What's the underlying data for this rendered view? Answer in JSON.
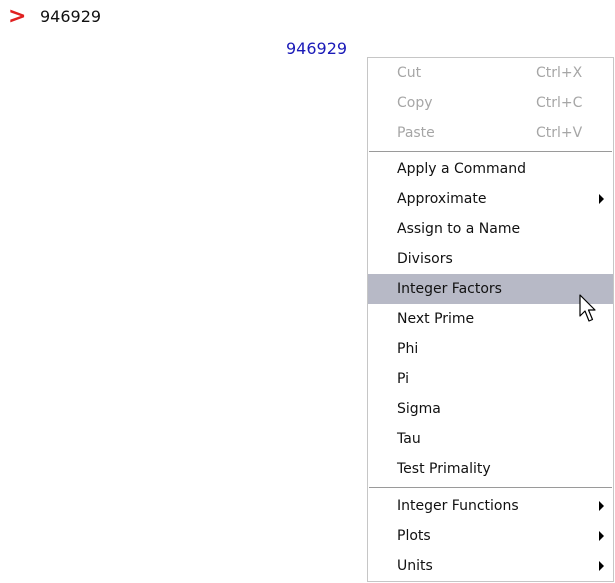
{
  "worksheet": {
    "prompt_symbol": ">",
    "input": "946929",
    "output": "946929"
  },
  "context_menu": {
    "edit_items": [
      {
        "label": "Cut",
        "shortcut": "Ctrl+X"
      },
      {
        "label": "Copy",
        "shortcut": "Ctrl+C"
      },
      {
        "label": "Paste",
        "shortcut": "Ctrl+V"
      }
    ],
    "command_items": [
      {
        "label": "Apply a Command"
      },
      {
        "label": "Approximate"
      },
      {
        "label": "Assign to a Name"
      },
      {
        "label": "Divisors"
      },
      {
        "label": "Integer Factors"
      },
      {
        "label": "Next Prime"
      },
      {
        "label": "Phi"
      },
      {
        "label": "Pi"
      },
      {
        "label": "Sigma"
      },
      {
        "label": "Tau"
      },
      {
        "label": "Test Primality"
      }
    ],
    "submenu_items": [
      {
        "label": "Integer Functions"
      },
      {
        "label": "Plots"
      },
      {
        "label": "Units"
      }
    ],
    "highlighted_item": "Integer Factors"
  },
  "colors": {
    "prompt": "#e02020",
    "output_text": "#1a1ab8",
    "disabled_text": "#a6a6a6",
    "highlight": "#b7b9c6"
  }
}
